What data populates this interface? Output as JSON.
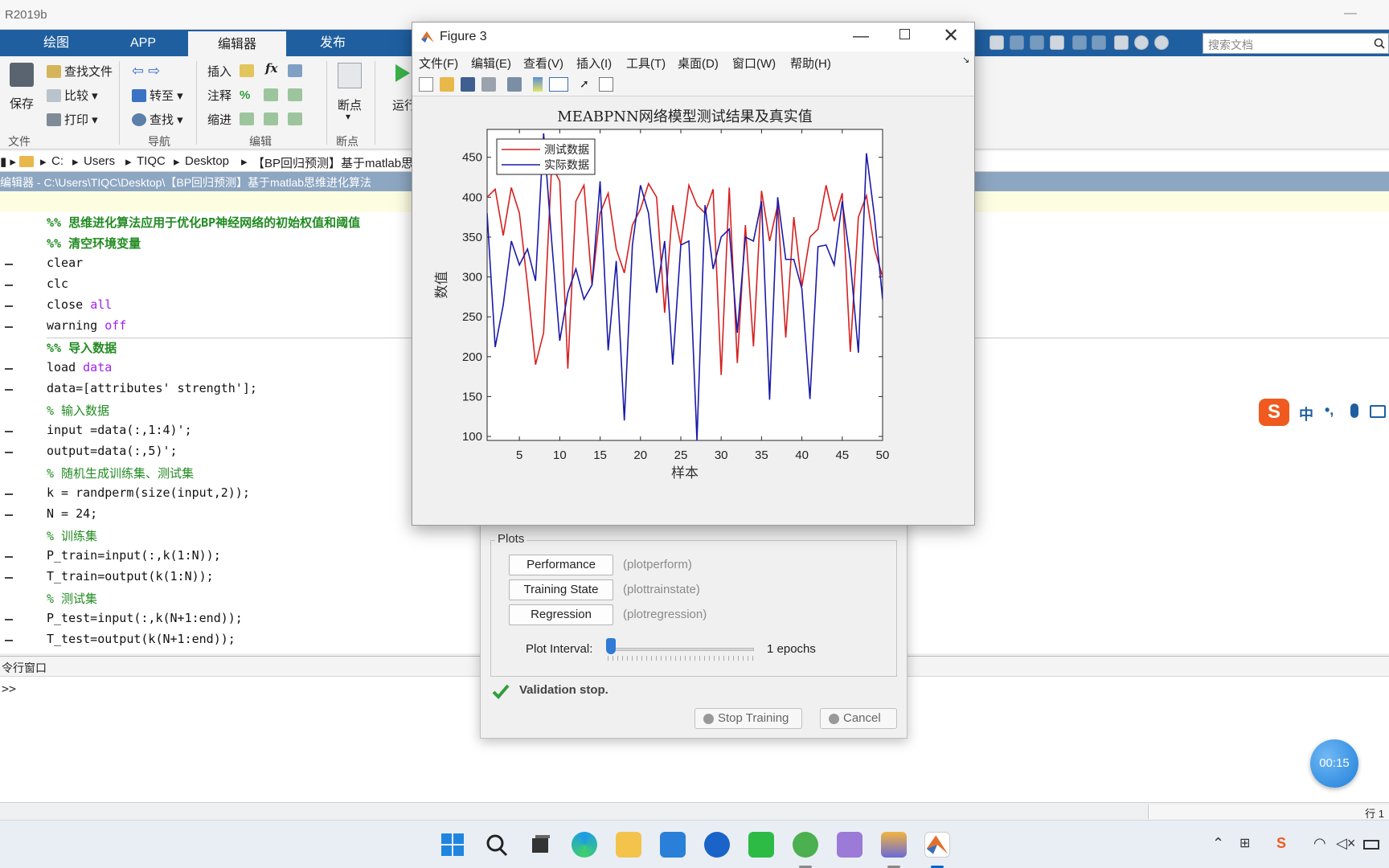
{
  "app": {
    "title": "R2019b",
    "minimize": "—"
  },
  "ribbon": {
    "tabs": [
      "绘图",
      "APP",
      "编辑器",
      "发布"
    ],
    "file_group": {
      "save": "保存",
      "find_files": "查找文件",
      "compare": "比较",
      "print": "打印",
      "label": "文件"
    },
    "nav_group": {
      "goto": "转至",
      "find": "查找",
      "label": "导航"
    },
    "edit_group": {
      "insert": "插入",
      "comment": "注释",
      "indent": "缩进",
      "fx": "fx",
      "label": "编辑"
    },
    "breakpoints_group": {
      "breakpoints": "断点",
      "label": "断点"
    },
    "run_group": {
      "run": "运行"
    }
  },
  "search": {
    "placeholder": "搜索文档"
  },
  "address": {
    "segments": [
      "C:",
      "Users",
      "TIQC",
      "Desktop",
      "【BP回归预测】基于matlab思"
    ]
  },
  "editor": {
    "title": "编辑器 - C:\\Users\\TIQC\\Desktop\\【BP回归预测】基于matlab思维进化算法",
    "lines": [
      "%% 思维进化算法应用于优化BP神经网络的初始权值和阈值",
      "%% 清空环境变量",
      "clear",
      "clc",
      "close ",
      "warning ",
      "%% 导入数据",
      "load ",
      "data=[attributes' strength'];",
      "% 输入数据",
      "input =data(:,1:4)';",
      "output=data(:,5)';",
      "% 随机生成训练集、测试集",
      "k = randperm(size(input,2));",
      "N = 24;",
      "% 训练集",
      "P_train=input(:,k(1:N));",
      "T_train=output(k(1:N));",
      "% 测试集",
      "P_test=input(:,k(N+1:end));",
      "T_test=output(k(N+1:end));"
    ],
    "keywords": {
      "all": "all",
      "off": "off",
      "data": "data"
    }
  },
  "command_window": {
    "title": "令行窗口",
    "prompt": ">>"
  },
  "status": {
    "line_label": "行 1"
  },
  "figure": {
    "title": "Figure 3",
    "menus": [
      "文件(F)",
      "编辑(E)",
      "查看(V)",
      "插入(I)",
      "工具(T)",
      "桌面(D)",
      "窗口(W)",
      "帮助(H)"
    ]
  },
  "nntraintool": {
    "plots_label": "Plots",
    "buttons": [
      {
        "label": "Performance",
        "cmd": "(plotperform)"
      },
      {
        "label": "Training State",
        "cmd": "(plottrainstate)"
      },
      {
        "label": "Regression",
        "cmd": "(plotregression)"
      }
    ],
    "interval_label": "Plot Interval:",
    "interval_value": "1 epochs",
    "interval_level": 0,
    "status": "Validation stop.",
    "stop_button": "Stop Training",
    "cancel_button": "Cancel"
  },
  "ime": {
    "lang": "中",
    "punct": "•,"
  },
  "timer": "00:15",
  "colors": {
    "ribbon_blue": "#1f5fa0",
    "test_series": "#d62020",
    "actual_series": "#1a1aa8"
  },
  "chart_data": {
    "type": "line",
    "title": "MEABPNN网络模型测试结果及真实值",
    "xlabel": "样本",
    "ylabel": "数值",
    "xlim": [
      1,
      50
    ],
    "ylim": [
      95,
      485
    ],
    "xticks": [
      5,
      10,
      15,
      20,
      25,
      30,
      35,
      40,
      45,
      50
    ],
    "yticks": [
      100,
      150,
      200,
      250,
      300,
      350,
      400,
      450
    ],
    "legend": "top-left",
    "x": [
      1,
      2,
      3,
      4,
      5,
      6,
      7,
      8,
      9,
      10,
      11,
      12,
      13,
      14,
      15,
      16,
      17,
      18,
      19,
      20,
      21,
      22,
      23,
      24,
      25,
      26,
      27,
      28,
      29,
      30,
      31,
      32,
      33,
      34,
      35,
      36,
      37,
      38,
      39,
      40,
      41,
      42,
      43,
      44,
      45,
      46,
      47,
      48,
      49,
      50
    ],
    "series": [
      {
        "name": "测试数据",
        "color": "#d62020",
        "values": [
          400,
          410,
          352,
          412,
          380,
          290,
          190,
          230,
          440,
          420,
          185,
          395,
          415,
          290,
          380,
          405,
          335,
          305,
          365,
          385,
          417,
          400,
          255,
          390,
          340,
          415,
          390,
          380,
          410,
          177,
          412,
          192,
          365,
          213,
          408,
          345,
          390,
          224,
          375,
          288,
          350,
          360,
          415,
          370,
          405,
          206,
          375,
          402,
          335,
          300
        ]
      },
      {
        "name": "实际数据",
        "color": "#1a1aa8",
        "values": [
          380,
          212,
          265,
          345,
          315,
          335,
          295,
          480,
          345,
          220,
          280,
          310,
          272,
          290,
          420,
          208,
          320,
          120,
          340,
          415,
          380,
          280,
          345,
          190,
          340,
          345,
          95,
          390,
          310,
          350,
          360,
          230,
          350,
          345,
          395,
          146,
          400,
          322,
          322,
          285,
          147,
          338,
          340,
          315,
          395,
          320,
          205,
          455,
          375,
          272
        ]
      }
    ]
  }
}
